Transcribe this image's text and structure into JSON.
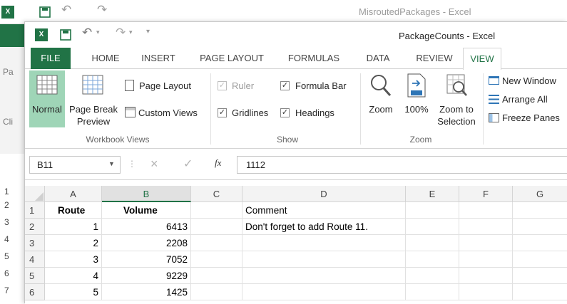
{
  "back_window": {
    "title": "MisroutedPackages - Excel",
    "partial_letters": [
      "Pa",
      "Cli"
    ],
    "row_numbers": [
      "1",
      "2",
      "3",
      "4",
      "5",
      "6",
      "7"
    ]
  },
  "front_window": {
    "title": "PackageCounts - Excel"
  },
  "tabs": [
    "FILE",
    "HOME",
    "INSERT",
    "PAGE LAYOUT",
    "FORMULAS",
    "DATA",
    "REVIEW",
    "VIEW"
  ],
  "active_tab": "VIEW",
  "ribbon": {
    "workbook_views": {
      "label": "Workbook Views",
      "normal": "Normal",
      "page_break_preview_line1": "Page Break",
      "page_break_preview_line2": "Preview",
      "page_layout": "Page Layout",
      "custom_views": "Custom Views"
    },
    "show": {
      "label": "Show",
      "ruler": "Ruler",
      "formula_bar": "Formula Bar",
      "gridlines": "Gridlines",
      "headings": "Headings"
    },
    "zoom": {
      "label": "Zoom",
      "zoom": "Zoom",
      "zoom_100": "100%",
      "zoom_to_selection_line1": "Zoom to",
      "zoom_to_selection_line2": "Selection"
    },
    "window": {
      "new_window": "New Window",
      "arrange_all": "Arrange All",
      "freeze_panes": "Freeze Panes"
    }
  },
  "formula_bar": {
    "name_box": "B11",
    "cancel_symbol": "×",
    "enter_symbol": "✓",
    "fx_label": "fx",
    "content": "1112"
  },
  "sheet": {
    "columns": [
      "A",
      "B",
      "C",
      "D",
      "E",
      "F",
      "G"
    ],
    "selected_column": "B",
    "row_numbers": [
      "1",
      "2",
      "3",
      "4",
      "5",
      "6"
    ],
    "headers": {
      "route": "Route",
      "volume": "Volume",
      "comment": "Comment"
    },
    "rows": [
      {
        "route": "1",
        "volume": "6413",
        "comment": "Don't forget to add Route 11."
      },
      {
        "route": "2",
        "volume": "2208",
        "comment": ""
      },
      {
        "route": "3",
        "volume": "7052",
        "comment": ""
      },
      {
        "route": "4",
        "volume": "9229",
        "comment": ""
      },
      {
        "route": "5",
        "volume": "1425",
        "comment": ""
      }
    ]
  },
  "colors": {
    "excel_green": "#217346",
    "selected_button": "#9fd5b7"
  }
}
